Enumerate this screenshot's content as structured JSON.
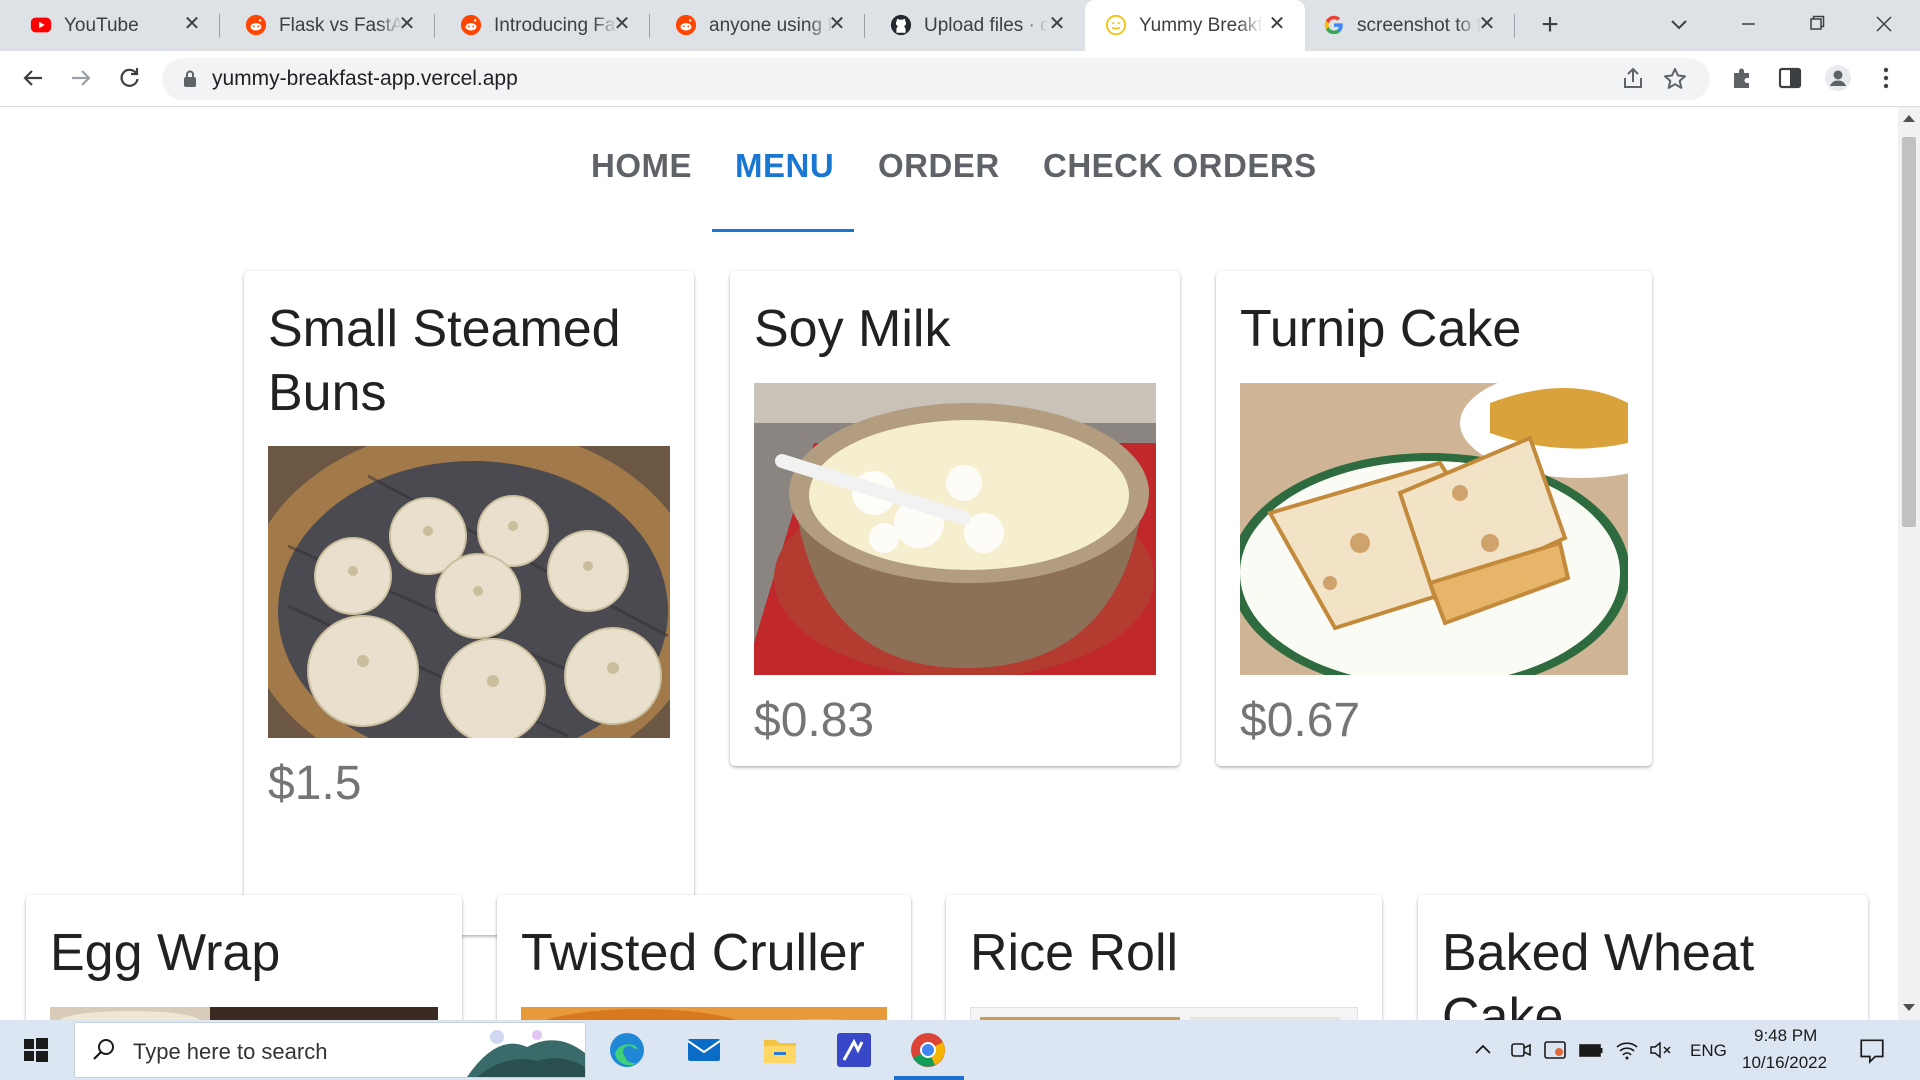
{
  "browser": {
    "tabs": [
      {
        "title": "YouTube",
        "icon": "youtube-icon"
      },
      {
        "title": "Flask vs FastAPI",
        "icon": "reddit-icon"
      },
      {
        "title": "Introducing FastAPI",
        "icon": "reddit-icon"
      },
      {
        "title": "anyone using FastAPI",
        "icon": "reddit-icon"
      },
      {
        "title": "Upload files · d",
        "icon": "github-icon"
      },
      {
        "title": "Yummy Breakfast",
        "icon": "smiley-favicon-icon"
      },
      {
        "title": "screenshot to f",
        "icon": "google-icon"
      }
    ],
    "active_tab": 5,
    "url": "yummy-breakfast-app.vercel.app"
  },
  "nav": {
    "items": [
      "HOME",
      "MENU",
      "ORDER",
      "CHECK ORDERS"
    ],
    "active": "MENU"
  },
  "menu": {
    "items": [
      {
        "name": "Small Steamed Buns",
        "price": "$1.5"
      },
      {
        "name": "Soy Milk",
        "price": "$0.83"
      },
      {
        "name": "Turnip Cake",
        "price": "$0.67"
      },
      {
        "name": "Egg Wrap",
        "price": ""
      },
      {
        "name": "Twisted Cruller",
        "price": ""
      },
      {
        "name": "Rice Roll",
        "price": ""
      },
      {
        "name": "Baked Wheat Cake",
        "price": ""
      }
    ]
  },
  "taskbar": {
    "search_placeholder": "Type here to search",
    "language": "ENG",
    "time": "9:48 PM",
    "date": "10/16/2022"
  },
  "colors": {
    "accent": "#1976d2",
    "tab_strip": "#dee1e6",
    "taskbar": "#dbe6f2"
  }
}
